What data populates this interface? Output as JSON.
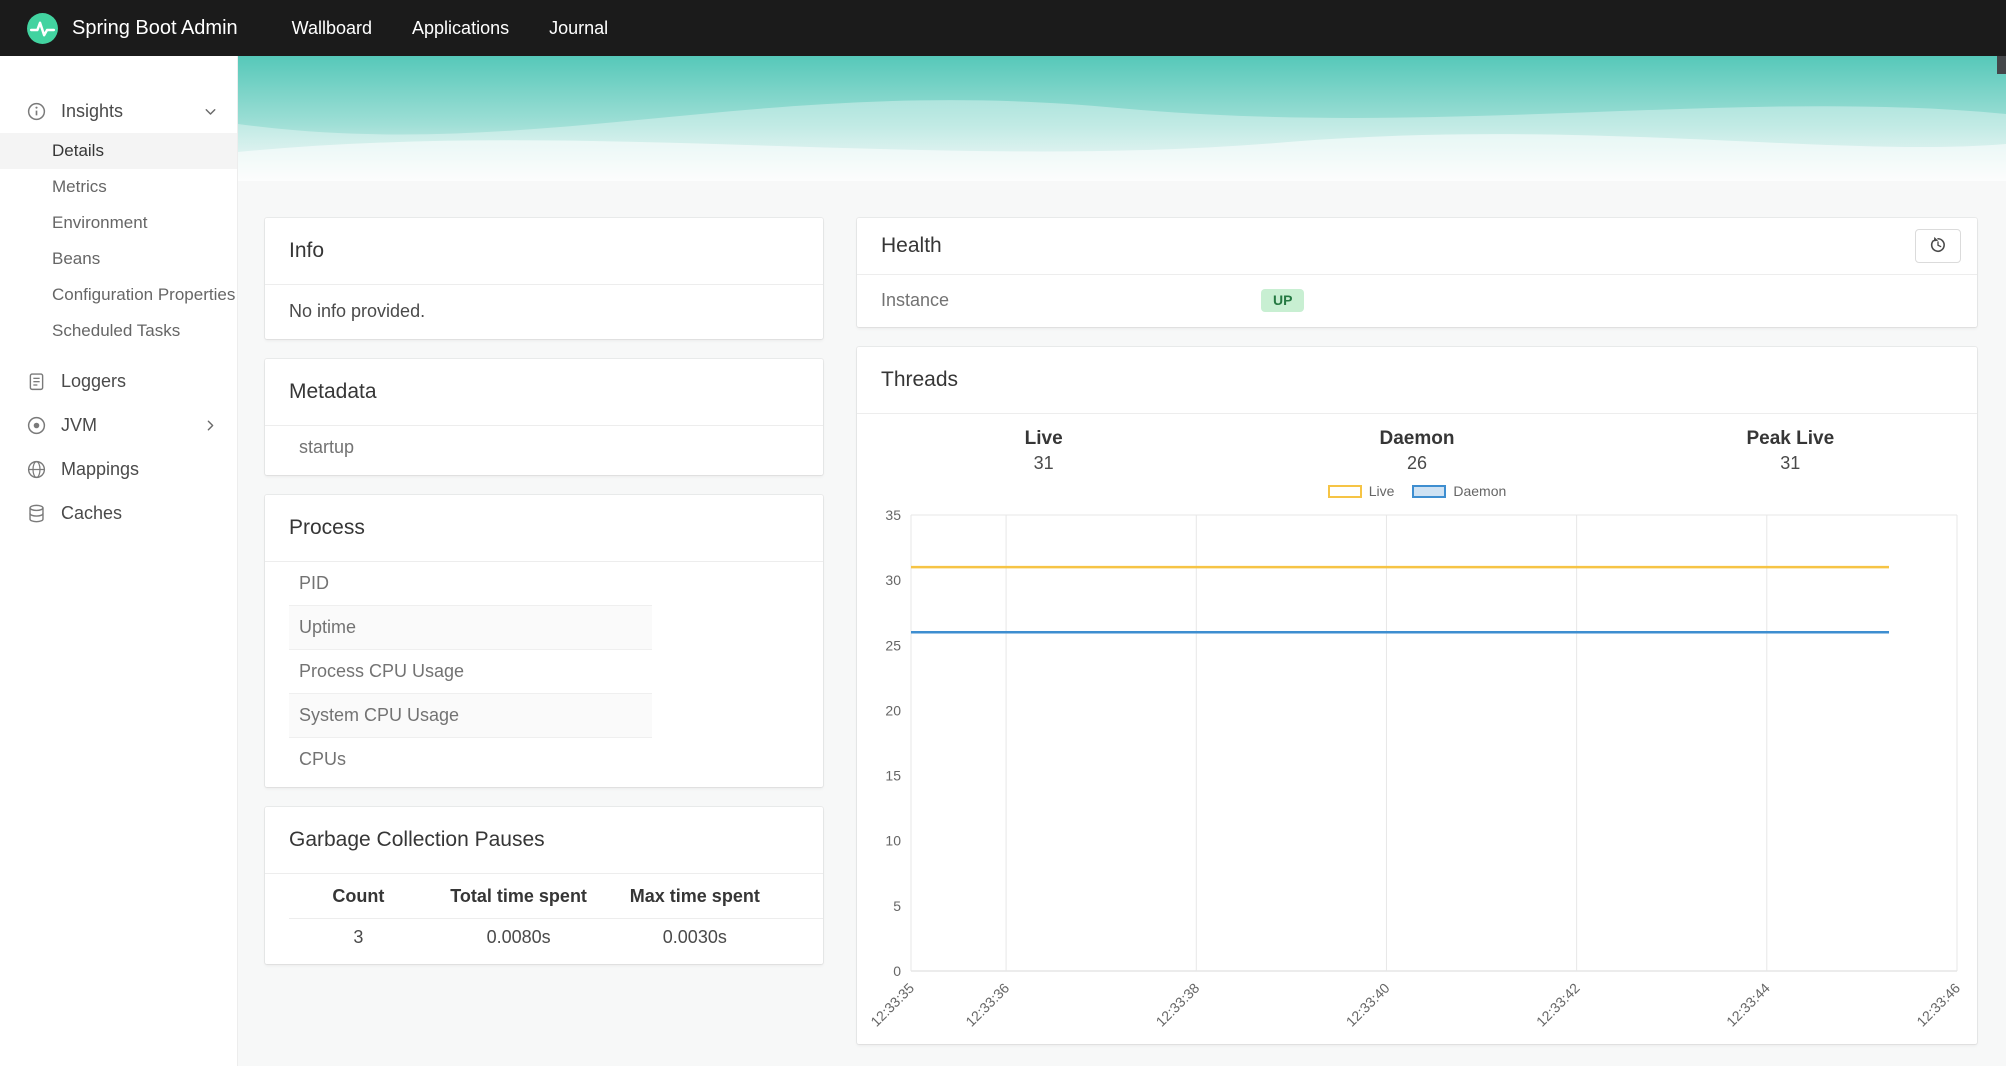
{
  "navbar": {
    "brand": "Spring Boot Admin",
    "links": [
      {
        "label": "Wallboard"
      },
      {
        "label": "Applications"
      },
      {
        "label": "Journal"
      }
    ]
  },
  "sidebar": {
    "insights": {
      "label": "Insights",
      "expanded": true,
      "items": [
        "Details",
        "Metrics",
        "Environment",
        "Beans",
        "Configuration Properties",
        "Scheduled Tasks"
      ],
      "active_item": "Details"
    },
    "loggers": {
      "label": "Loggers"
    },
    "jvm": {
      "label": "JVM",
      "collapsed": true
    },
    "mappings": {
      "label": "Mappings"
    },
    "caches": {
      "label": "Caches"
    }
  },
  "info_card": {
    "title": "Info",
    "body": "No info provided."
  },
  "metadata_card": {
    "title": "Metadata",
    "rows": [
      "startup"
    ]
  },
  "process_card": {
    "title": "Process",
    "rows": [
      "PID",
      "Uptime",
      "Process CPU Usage",
      "System CPU Usage",
      "CPUs"
    ]
  },
  "gc_card": {
    "title": "Garbage Collection Pauses",
    "columns": [
      "Count",
      "Total time spent",
      "Max time spent"
    ],
    "values": [
      "3",
      "0.0080s",
      "0.0030s"
    ]
  },
  "health_card": {
    "title": "Health",
    "rows": [
      {
        "label": "Instance",
        "status": "UP"
      }
    ]
  },
  "threads_card": {
    "title": "Threads",
    "stats": [
      {
        "label": "Live",
        "value": "31"
      },
      {
        "label": "Daemon",
        "value": "26"
      },
      {
        "label": "Peak Live",
        "value": "31"
      }
    ]
  },
  "chart_data": {
    "type": "line",
    "title": "Threads",
    "x_tick_labels": [
      "12:33:35",
      "12:33:36",
      "12:33:38",
      "12:33:40",
      "12:33:42",
      "12:33:44",
      "12:33:46"
    ],
    "x_tick_seconds": [
      35,
      36,
      38,
      40,
      42,
      44,
      46
    ],
    "x_range_seconds": [
      35,
      46
    ],
    "data_end_fraction": 0.935,
    "ylim": [
      0,
      35
    ],
    "y_ticks": [
      0,
      5,
      10,
      15,
      20,
      25,
      30,
      35
    ],
    "grid": "vertical-only",
    "legend_position": "top",
    "series": [
      {
        "name": "Live",
        "color": "#f6c445",
        "fill": "#ffffff",
        "value": 31
      },
      {
        "name": "Daemon",
        "color": "#3e8ed0",
        "fill": "#cfe2f3",
        "value": 26
      }
    ]
  },
  "colors": {
    "navbar_bg": "#1b1b1b",
    "brand_green": "#42d3a0",
    "wave_teal": "#56c8b9",
    "up_badge_bg": "#c8efd2",
    "up_badge_text": "#257942",
    "live_line": "#f6c445",
    "daemon_line": "#3e8ed0"
  }
}
